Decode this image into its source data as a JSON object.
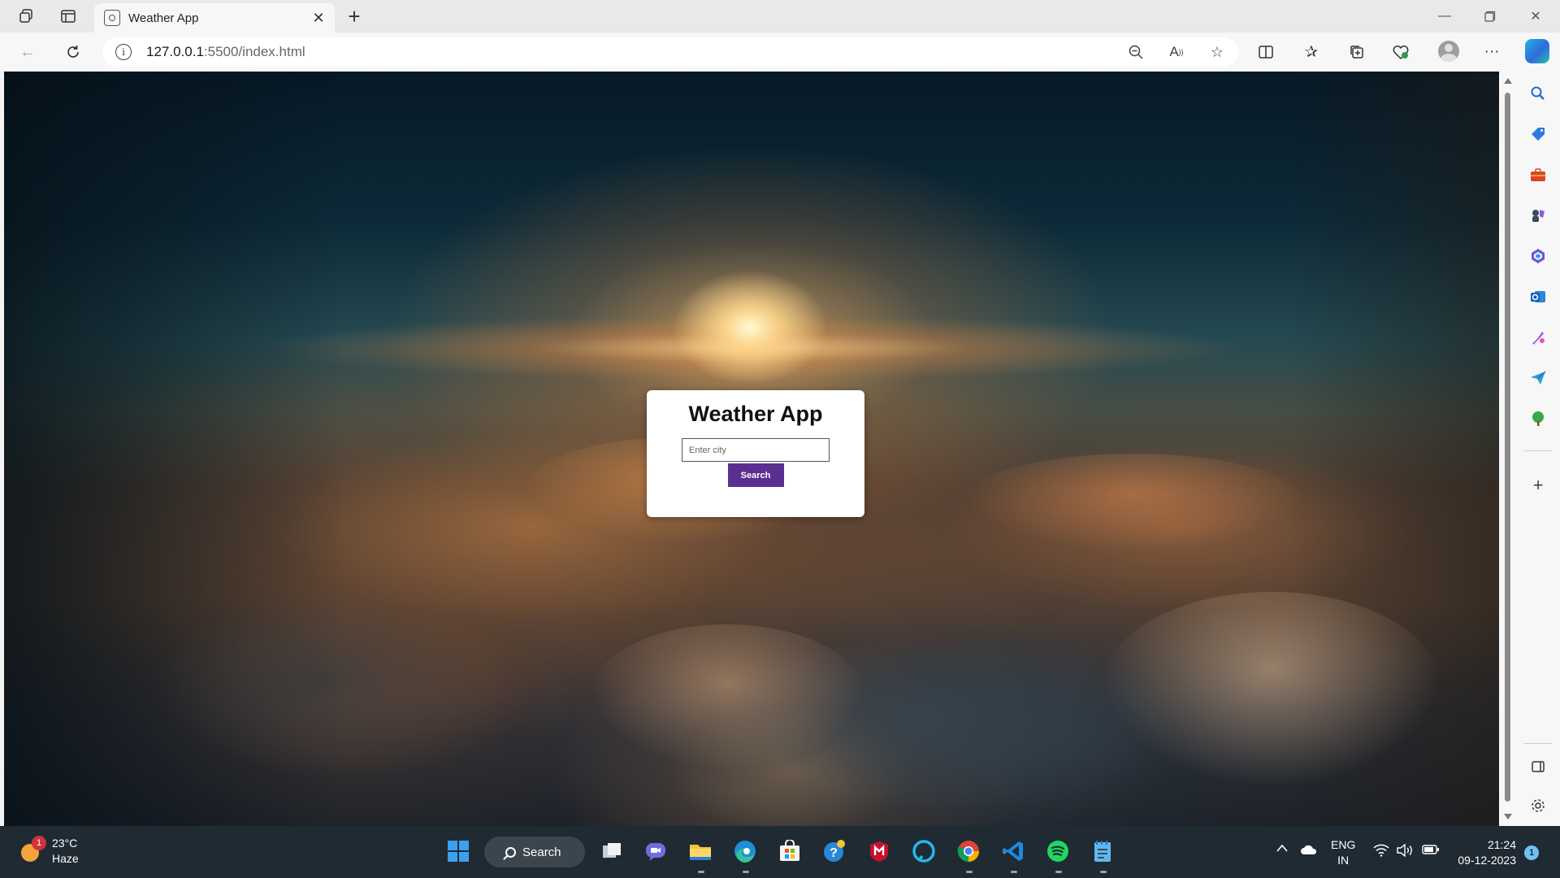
{
  "browser": {
    "tab": {
      "title": "Weather App",
      "close_icon": "close-icon"
    },
    "new_tab_label": "+",
    "address": {
      "host": "127.0.0.1",
      "path": ":5500/index.html"
    }
  },
  "page": {
    "heading": "Weather App",
    "city_input": {
      "placeholder": "Enter city",
      "value": ""
    },
    "search_button": "Search",
    "button_color": "#5b2f91"
  },
  "taskbar": {
    "weather": {
      "badge": "1",
      "temp": "23°C",
      "condition": "Haze"
    },
    "search_label": "Search",
    "language": {
      "lang": "ENG",
      "region": "IN"
    },
    "clock": {
      "time": "21:24",
      "date": "09-12-2023"
    },
    "notification_count": "1"
  }
}
